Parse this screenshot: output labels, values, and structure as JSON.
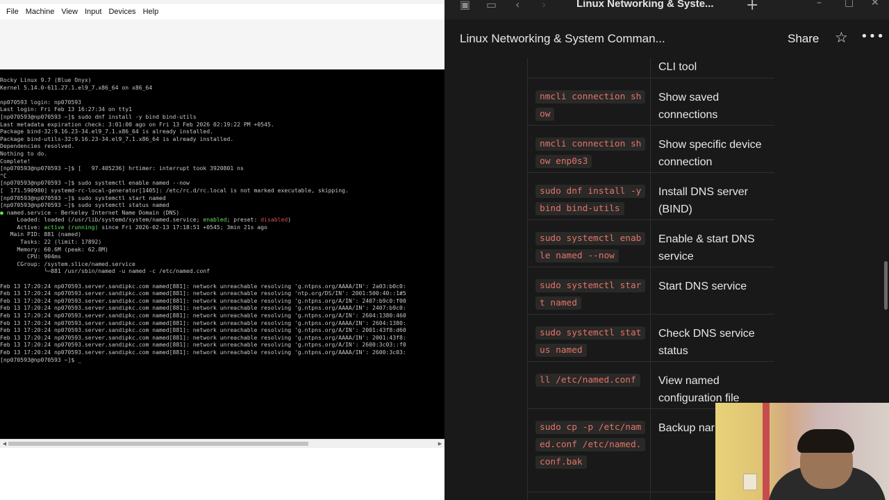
{
  "vm": {
    "menu": [
      "File",
      "Machine",
      "View",
      "Input",
      "Devices",
      "Help"
    ],
    "terminal_lines": [
      [
        {
          "t": "Rocky Linux 9.7 (Blue Onyx)"
        }
      ],
      [
        {
          "t": "Kernel 5.14.0-611.27.1.el9_7.x86_64 on x86_64"
        }
      ],
      [
        {
          "t": ""
        }
      ],
      [
        {
          "t": "np070593 login: np070593"
        }
      ],
      [
        {
          "t": "Last login: Fri Feb 13 16:27:34 on tty1"
        }
      ],
      [
        {
          "t": "[np070593@np070593 ~]$ sudo dnf install -y bind bind-utils"
        }
      ],
      [
        {
          "t": "Last metadata expiration check: 3:01:00 ago on Fri 13 Feb 2026 02:19:22 PM +0545."
        }
      ],
      [
        {
          "t": "Package bind-32:9.16.23-34.el9_7.1.x86_64 is already installed."
        }
      ],
      [
        {
          "t": "Package bind-utils-32:9.16.23-34.el9_7.1.x86_64 is already installed."
        }
      ],
      [
        {
          "t": "Dependencies resolved."
        }
      ],
      [
        {
          "t": "Nothing to do."
        }
      ],
      [
        {
          "t": "Complete!"
        }
      ],
      [
        {
          "t": "[np070593@np070593 ~]$ [   97.405236] hrtimer: interrupt took 3920801 ns"
        }
      ],
      [
        {
          "t": "^C"
        }
      ],
      [
        {
          "t": "[np070593@np070593 ~]$ sudo systemctl enable named --now"
        }
      ],
      [
        {
          "t": "[  171.590980] systemd-rc-local-generator[1405]: /etc/rc.d/rc.local is not marked executable, skipping."
        }
      ],
      [
        {
          "t": "[np070593@np070593 ~]$ sudo systemctl start named"
        }
      ],
      [
        {
          "t": "[np070593@np070593 ~]$ sudo systemctl status named"
        }
      ],
      [
        {
          "t": "●",
          "c": "t-green"
        },
        {
          "t": " named.service - Berkeley Internet Name Domain (DNS)"
        }
      ],
      [
        {
          "t": "     Loaded: loaded (/usr/lib/systemd/system/named.service; "
        },
        {
          "t": "enabled",
          "c": "t-green"
        },
        {
          "t": "; preset: "
        },
        {
          "t": "disabled",
          "c": "t-red"
        },
        {
          "t": ")"
        }
      ],
      [
        {
          "t": "     Active: "
        },
        {
          "t": "active (running)",
          "c": "t-green"
        },
        {
          "t": " since Fri 2026-02-13 17:18:51 +0545; 3min 21s ago"
        }
      ],
      [
        {
          "t": "   Main PID: 881 (named)"
        }
      ],
      [
        {
          "t": "      Tasks: 22 (limit: 17892)"
        }
      ],
      [
        {
          "t": "     Memory: 60.6M (peak: 62.8M)"
        }
      ],
      [
        {
          "t": "        CPU: 904ms"
        }
      ],
      [
        {
          "t": "     CGroup: /system.slice/named.service"
        }
      ],
      [
        {
          "t": "             └─881 /usr/sbin/named -u named -c /etc/named.conf"
        }
      ],
      [
        {
          "t": ""
        }
      ],
      [
        {
          "t": "Feb 13 17:20:24 np070593.server.sandipkc.com named[881]: network unreachable resolving 'g.ntpns.org/AAAA/IN': 2a03:b0c0:"
        }
      ],
      [
        {
          "t": "Feb 13 17:20:24 np070593.server.sandipkc.com named[881]: network unreachable resolving 'ntp.org/DS/IN': 2001:500:40::1#5"
        }
      ],
      [
        {
          "t": "Feb 13 17:20:24 np070593.server.sandipkc.com named[881]: network unreachable resolving 'g.ntpns.org/A/IN': 2407:b9c0:f00"
        }
      ],
      [
        {
          "t": "Feb 13 17:20:24 np070593.server.sandipkc.com named[881]: network unreachable resolving 'g.ntpns.org/AAAA/IN': 2407:b9c0:"
        }
      ],
      [
        {
          "t": "Feb 13 17:20:24 np070593.server.sandipkc.com named[881]: network unreachable resolving 'g.ntpns.org/A/IN': 2604:1380:460"
        }
      ],
      [
        {
          "t": "Feb 13 17:20:24 np070593.server.sandipkc.com named[881]: network unreachable resolving 'g.ntpns.org/AAAA/IN': 2604:1380:"
        }
      ],
      [
        {
          "t": "Feb 13 17:20:24 np070593.server.sandipkc.com named[881]: network unreachable resolving 'g.ntpns.org/A/IN': 2001:43f8:d60"
        }
      ],
      [
        {
          "t": "Feb 13 17:20:24 np070593.server.sandipkc.com named[881]: network unreachable resolving 'g.ntpns.org/AAAA/IN': 2001:43f8:"
        }
      ],
      [
        {
          "t": "Feb 13 17:20:24 np070593.server.sandipkc.com named[881]: network unreachable resolving 'g.ntpns.org/A/IN': 2600:3c03::f0"
        }
      ],
      [
        {
          "t": "Feb 13 17:20:24 np070593.server.sandipkc.com named[881]: network unreachable resolving 'g.ntpns.org/AAAA/IN': 2600:3c03:"
        }
      ],
      [
        {
          "t": "[np070593@np070593 ~]$ "
        },
        {
          "t": "_",
          "c": "cursor"
        }
      ]
    ]
  },
  "notion": {
    "tab_title": "Linux Networking & Syste...",
    "page_title": "Linux Networking & System Comman...",
    "share_label": "Share",
    "icons": {
      "back": "chevron-left-icon",
      "forward": "chevron-right-icon",
      "star": "star-icon",
      "more": "more-icon",
      "new_tab": "plus-icon"
    },
    "rows": [
      {
        "cmd": "",
        "desc": "CLI tool"
      },
      {
        "cmd": "nmcli connection show",
        "desc": "Show saved connections"
      },
      {
        "cmd": "nmcli connection show enp0s3",
        "desc": "Show specific device connection"
      },
      {
        "cmd": "sudo dnf install -y bind bind-utils",
        "desc": "Install DNS server (BIND)"
      },
      {
        "cmd": "sudo systemctl enable named --now",
        "desc": "Enable & start DNS service"
      },
      {
        "cmd": "sudo systemctl start named",
        "desc": "Start DNS service"
      },
      {
        "cmd": "sudo systemctl status named",
        "desc": "Check DNS service status"
      },
      {
        "cmd": "ll /etc/named.conf",
        "desc": "View named configuration file"
      },
      {
        "cmd": "sudo cp -p /etc/named.conf /etc/named.conf.bak",
        "desc": "Backup nar"
      },
      {
        "cmd": "",
        "desc": ""
      }
    ]
  }
}
